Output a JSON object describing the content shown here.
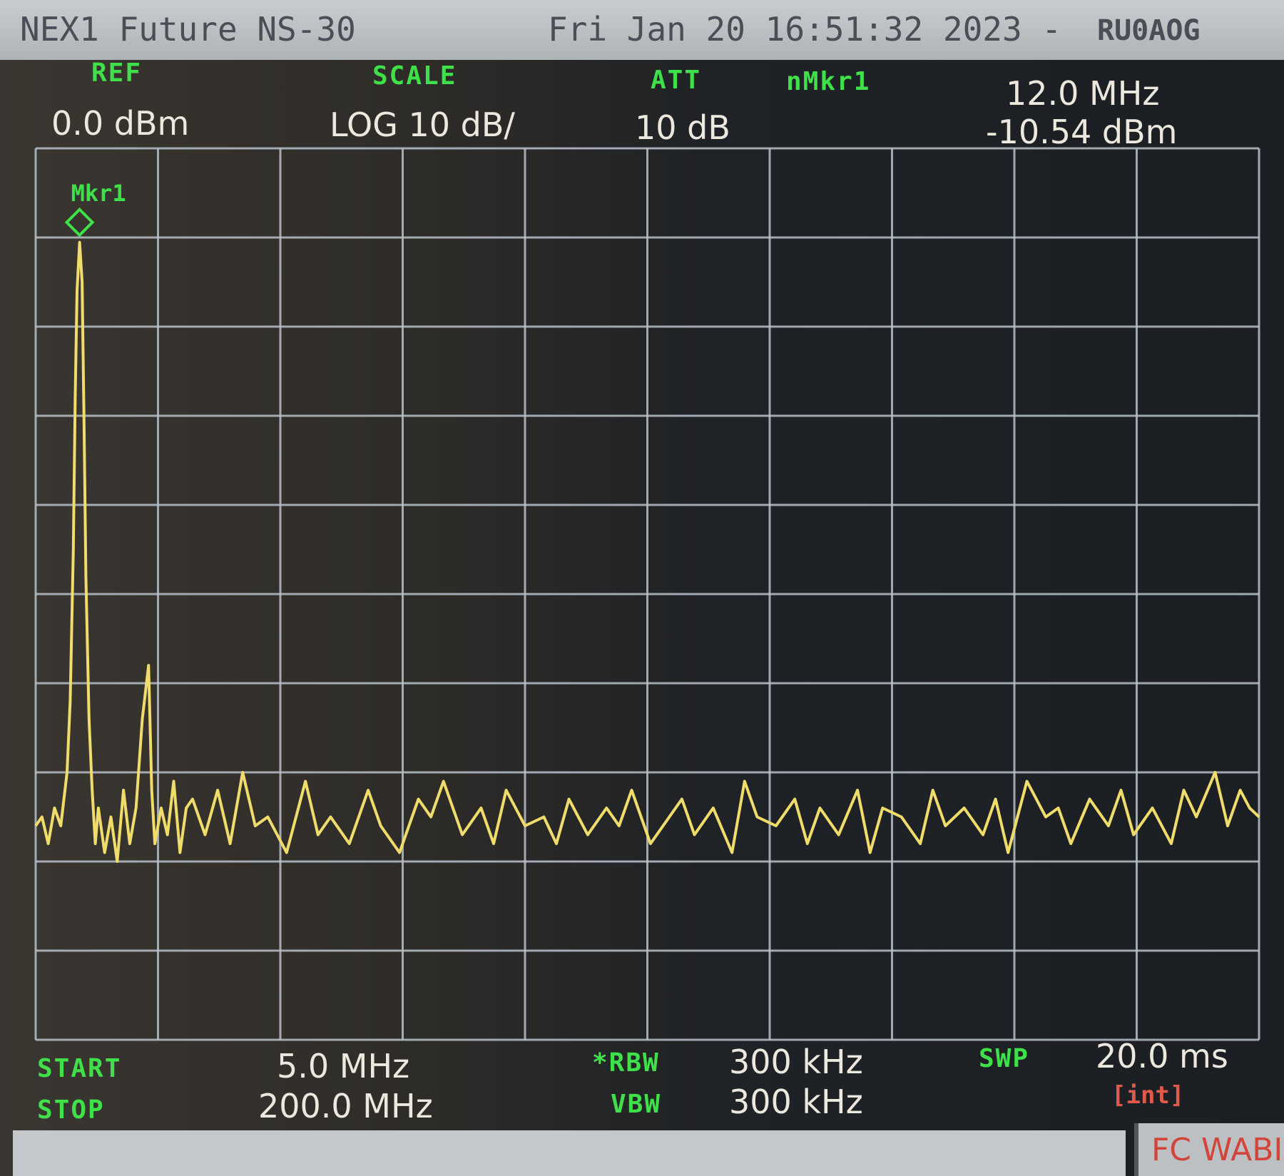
{
  "header": {
    "model": "NEX1 Future NS-30",
    "datetime": "Fri Jan 20 16:51:32 2023 -",
    "callsign": "RU0AOG"
  },
  "settings": {
    "ref_label": "REF",
    "ref_value": "0.0 dBm",
    "scale_label": "SCALE",
    "scale_value": "LOG 10 dB/",
    "att_label": "ATT",
    "att_value": "10 dB",
    "marker_label": "nMkr1",
    "marker_freq": "12.0 MHz",
    "marker_level": "-10.54 dBm"
  },
  "footer": {
    "start_label": "START",
    "start_value": "5.0 MHz",
    "stop_label": "STOP",
    "stop_value": "200.0 MHz",
    "rbw_label": "*RBW",
    "rbw_value": "300 kHz",
    "vbw_label": "VBW",
    "vbw_value": "300 kHz",
    "swp_label": "SWP",
    "swp_value": "20.0 ms",
    "swp_mode": "[int]",
    "status": "FC WABI"
  },
  "colors": {
    "trace": "#f0dc6a",
    "grid": "#b8c0c8",
    "label_green": "#3fe04a",
    "text_white": "#ece8de"
  },
  "chart_data": {
    "type": "line",
    "title": "",
    "xlabel": "",
    "ylabel": "",
    "xlim": [
      5.0,
      200.0
    ],
    "ylim": [
      -100,
      0
    ],
    "x_unit": "MHz",
    "y_unit": "dBm",
    "grid": true,
    "marker": {
      "label": "Mkr1",
      "x": 12.0,
      "y": -10.54
    },
    "series": [
      {
        "x": [
          5.0,
          6.0,
          7.0,
          8.0,
          9.0,
          10.0,
          10.5,
          11.0,
          11.3,
          11.6,
          12.0,
          12.4,
          12.7,
          13.0,
          13.5,
          14.0,
          14.5,
          15.0,
          16.0,
          17.0,
          18.0,
          19.0,
          20.0,
          21.0,
          22.0,
          23.0,
          23.5,
          24.0,
          25.0,
          26.0,
          27.0,
          28.0,
          29.0,
          30.0,
          32.0,
          34.0,
          36.0,
          38.0,
          40.0,
          42.0,
          45.0,
          48.0,
          50.0,
          52.0,
          55.0,
          58.0,
          60.0,
          63.0,
          66.0,
          68.0,
          70.0,
          73.0,
          76.0,
          78.0,
          80.0,
          83.0,
          86.0,
          88.0,
          90.0,
          93.0,
          96.0,
          98.0,
          100.0,
          103.0,
          106.0,
          108.0,
          110.0,
          113.0,
          116.0,
          118.0,
          120.0,
          123.0,
          126.0,
          128.0,
          130.0,
          133.0,
          136.0,
          138.0,
          140.0,
          143.0,
          146.0,
          148.0,
          150.0,
          153.0,
          156.0,
          158.0,
          160.0,
          163.0,
          166.0,
          168.0,
          170.0,
          173.0,
          176.0,
          178.0,
          180.0,
          183.0,
          186.0,
          188.0,
          190.0,
          193.0,
          195.0,
          197.0,
          198.5,
          200.0
        ],
        "y": [
          -76,
          -75,
          -78,
          -74,
          -76,
          -70,
          -62,
          -45,
          -28,
          -16,
          -10.54,
          -15,
          -30,
          -48,
          -64,
          -72,
          -78,
          -74,
          -79,
          -75,
          -80,
          -72,
          -78,
          -74,
          -64,
          -58,
          -72,
          -78,
          -74,
          -77,
          -71,
          -79,
          -74,
          -73,
          -77,
          -72,
          -78,
          -70,
          -76,
          -75,
          -79,
          -71,
          -77,
          -75,
          -78,
          -72,
          -76,
          -79,
          -73,
          -75,
          -71,
          -77,
          -74,
          -78,
          -72,
          -76,
          -75,
          -78,
          -73,
          -77,
          -74,
          -76,
          -72,
          -78,
          -75,
          -73,
          -77,
          -74,
          -79,
          -71,
          -75,
          -76,
          -73,
          -78,
          -74,
          -77,
          -72,
          -79,
          -74,
          -75,
          -78,
          -72,
          -76,
          -74,
          -77,
          -73,
          -79,
          -71,
          -75,
          -74,
          -78,
          -73,
          -76,
          -72,
          -77,
          -74,
          -78,
          -72,
          -75,
          -70,
          -76,
          -72,
          -74,
          -75
        ]
      }
    ]
  }
}
